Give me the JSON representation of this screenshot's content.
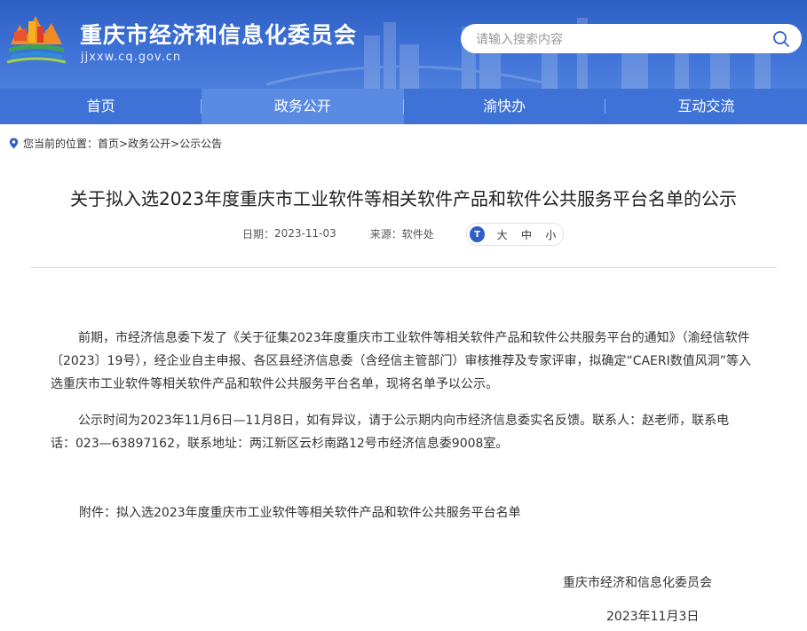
{
  "header": {
    "site_title": "重庆市经济和信息化委员会",
    "site_domain": "jjxxw.cq.gov.cn",
    "search_placeholder": "请输入搜索内容"
  },
  "nav": {
    "items": [
      {
        "label": "首页"
      },
      {
        "label": "政务公开"
      },
      {
        "label": "渝快办"
      },
      {
        "label": "互动交流"
      }
    ],
    "active_index": 1
  },
  "breadcrumb": {
    "prefix": "您当前的位置：",
    "items": [
      "首页",
      "政务公开",
      "公示公告"
    ],
    "separator": " >"
  },
  "article": {
    "title": "关于拟入选2023年度重庆市工业软件等相关软件产品和软件公共服务平台名单的公示",
    "date_label": "日期：",
    "date": "2023-11-03",
    "source_label": "来源：",
    "source": "软件处",
    "font_size": {
      "icon_text": "T",
      "large": "大",
      "medium": "中",
      "small": "小"
    },
    "paragraphs": [
      "前期，市经济信息委下发了《关于征集2023年度重庆市工业软件等相关软件产品和软件公共服务平台的通知》（渝经信软件〔2023〕19号），经企业自主申报、各区县经济信息委（含经信主管部门）审核推荐及专家评审，拟确定“CAERI数值风洞”等入选重庆市工业软件等相关软件产品和软件公共服务平台名单，现将名单予以公示。",
      "公示时间为2023年11月6日—11月8日，如有异议，请于公示期内向市经济信息委实名反馈。联系人：赵老师，联系电话：023—63897162，联系地址：两江新区云杉南路12号市经济信息委9008室。"
    ],
    "attachment": "附件：拟入选2023年度重庆市工业软件等相关软件产品和软件公共服务平台名单",
    "signature_org": "重庆市经济和信息化委员会",
    "signature_date": "2023年11月3日"
  },
  "colors": {
    "header_blue": "#2f5fc4",
    "nav_blue": "#3f72d6",
    "nav_active": "#5a8ae2"
  }
}
